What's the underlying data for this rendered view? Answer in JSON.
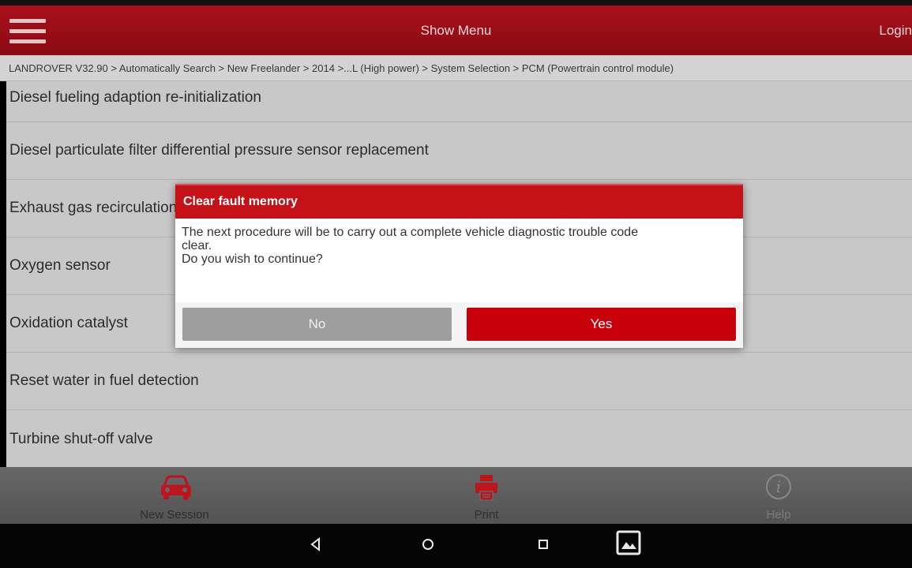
{
  "header": {
    "menu_title": "Show Menu",
    "login_label": "Login"
  },
  "breadcrumb": "LANDROVER V32.90 > Automatically Search > New Freelander > 2014 >...L (High power) > System Selection > PCM (Powertrain control module)",
  "list": {
    "items": [
      "Diesel fueling adaption re-initialization",
      "Diesel particulate filter differential pressure sensor replacement",
      "Exhaust gas recirculation",
      "Oxygen sensor",
      "Oxidation catalyst",
      "Reset water in fuel detection",
      "Turbine shut-off valve"
    ]
  },
  "dialog": {
    "title": "Clear fault memory",
    "message_line1": "The next procedure will be to carry out a complete vehicle diagnostic trouble code",
    "message_line2": "clear.",
    "message_line3": "Do you wish to continue?",
    "no_label": "No",
    "yes_label": "Yes"
  },
  "bottom_nav": {
    "new_session": "New Session",
    "print": "Print",
    "help": "Help"
  },
  "icons": {
    "new_session": "car-icon",
    "print": "printer-icon",
    "help": "info-icon"
  },
  "colors": {
    "header_red": "#a8111c",
    "dialog_red": "#c51118",
    "yes_red": "#c8000c",
    "no_gray": "#9e9e9e",
    "icon_red": "#c0161f"
  }
}
